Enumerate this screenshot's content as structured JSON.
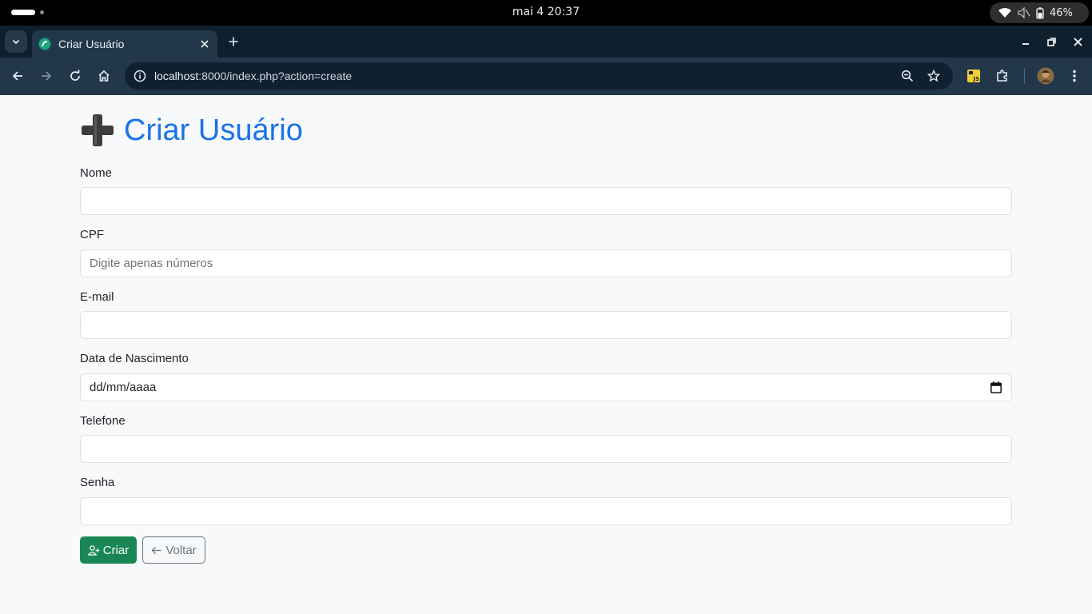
{
  "os": {
    "clock": "mai 4  20:37",
    "battery": "46%"
  },
  "browser": {
    "tab_title": "Criar Usuário",
    "url_host": "localhost",
    "url_rest": ":8000/index.php?action=create"
  },
  "page": {
    "title": "Criar Usuário",
    "fields": {
      "nome_label": "Nome",
      "cpf_label": "CPF",
      "cpf_placeholder": "Digite apenas números",
      "email_label": "E-mail",
      "nascimento_label": "Data de Nascimento",
      "nascimento_value": "dd/mm/aaaa",
      "telefone_label": "Telefone",
      "senha_label": "Senha"
    },
    "buttons": {
      "create_label": "Criar",
      "back_label": "Voltar"
    }
  },
  "colors": {
    "title": "#1a73e8",
    "create_button": "#198754",
    "back_button": "#6c757d",
    "page_background": "#f8f9fa"
  }
}
